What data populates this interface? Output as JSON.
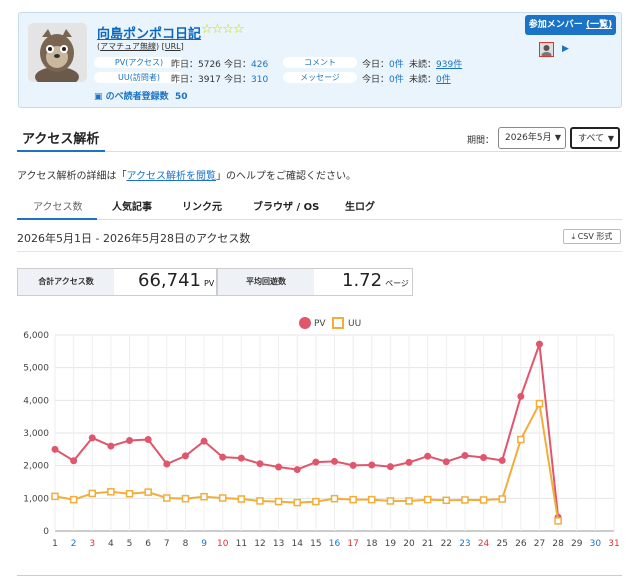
{
  "profile": {
    "blog_title": "向島ポンポコ日記",
    "rating": "☆☆☆☆",
    "sub_amateur": "アマチュア無線",
    "sub_url": "URL",
    "pv_label": "PV(アクセス)",
    "uu_label": "UU(訪問者)",
    "pv_yesterday": "昨日：5726",
    "pv_today_prefix": "今日：",
    "pv_today": "426",
    "uu_yesterday": "昨日：3917",
    "uu_today_prefix": "今日：",
    "uu_today": "310",
    "comment_label": "コメント",
    "message_label": "メッセージ",
    "comment_today_prefix": "今日：",
    "comment_today": "0件",
    "comment_unread_prefix": "未読：",
    "comment_unread": "939件",
    "message_today_prefix": "今日：",
    "message_today": "0件",
    "message_unread_prefix": "未読：",
    "message_unread": "0件",
    "reader_label": "のべ読者登録数",
    "reader_count": "50",
    "member_button": "参加メンバー",
    "member_list_link": "(一覧)"
  },
  "section": {
    "title": "アクセス解析",
    "period_label": "期間：",
    "period_value": "2026年5月",
    "filter_value": "すべて",
    "desc_prefix": "アクセス解析の詳細は「",
    "desc_link": "アクセス解析を閲覧",
    "desc_suffix": "」のヘルプをご確認ください。"
  },
  "tabs": [
    "アクセス数",
    "人気記事",
    "リンク元",
    "ブラウザ / OS",
    "生ログ"
  ],
  "date_range": "2026年5月1日 - 2026年5月28日のアクセス数",
  "csv_button": "CSV 形式",
  "summary": {
    "total_label": "合計アクセス数",
    "total_value": "66,741",
    "total_unit": "PV",
    "avg_label": "平均回遊数",
    "avg_value": "1.72",
    "avg_unit": "ページ"
  },
  "colors": {
    "pv": "#e0566c",
    "uu": "#f2ad3a",
    "accent": "#1a73c7",
    "saturday": "#1a73c7",
    "sunday": "#e0303c"
  },
  "chart_data": {
    "type": "line",
    "x": [
      "1",
      "2",
      "3",
      "4",
      "5",
      "6",
      "7",
      "8",
      "9",
      "10",
      "11",
      "12",
      "13",
      "14",
      "15",
      "16",
      "17",
      "18",
      "19",
      "20",
      "21",
      "22",
      "23",
      "24",
      "25",
      "26",
      "27",
      "28",
      "29",
      "30",
      "31"
    ],
    "saturdays": [
      "2",
      "9",
      "16",
      "23",
      "30"
    ],
    "sundays": [
      "3",
      "10",
      "17",
      "24",
      "31"
    ],
    "ylim": [
      0,
      6000
    ],
    "yticks": [
      "0",
      "1,000",
      "2,000",
      "3,000",
      "4,000",
      "5,000",
      "6,000"
    ],
    "series": [
      {
        "name": "PV",
        "values": [
          2500,
          2150,
          2850,
          2600,
          2770,
          2800,
          2050,
          2300,
          2750,
          2260,
          2230,
          2060,
          1960,
          1880,
          2110,
          2130,
          2010,
          2020,
          1970,
          2100,
          2290,
          2120,
          2310,
          2250,
          2160,
          4120,
          5720,
          420
        ]
      },
      {
        "name": "UU",
        "values": [
          1060,
          960,
          1150,
          1200,
          1140,
          1190,
          1010,
          990,
          1050,
          1010,
          980,
          920,
          900,
          870,
          900,
          990,
          960,
          960,
          920,
          920,
          960,
          940,
          950,
          950,
          980,
          2800,
          3900,
          310
        ]
      }
    ],
    "grid": true,
    "legend": "top-center"
  }
}
